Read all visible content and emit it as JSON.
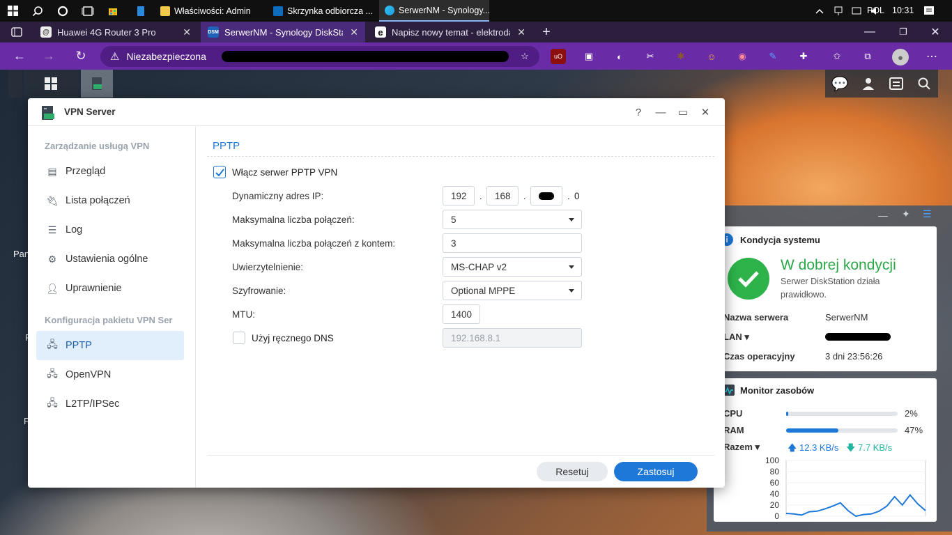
{
  "taskbar": {
    "apps": [
      {
        "label": "Właściwości: Admin"
      },
      {
        "label": "Skrzynka odbiorcza ..."
      },
      {
        "label": "SerwerNM - Synology..."
      }
    ],
    "lang": "POL",
    "time": "10:31"
  },
  "browser": {
    "tabs": [
      {
        "label": "Huawei 4G Router 3 Pro"
      },
      {
        "label": "SerwerNM - Synology DiskStation"
      },
      {
        "label": "Napisz nowy temat - elektroda.p"
      }
    ],
    "security_label": "Niezabezpieczona"
  },
  "desktop": {
    "side_labels": [
      "Pan",
      "P",
      "P"
    ]
  },
  "window": {
    "title": "VPN Server",
    "sections": [
      {
        "title": "Zarządzanie usługą VPN",
        "items": [
          "Przegląd",
          "Lista połączeń",
          "Log",
          "Ustawienia ogólne",
          "Uprawnienie"
        ]
      },
      {
        "title": "Konfiguracja pakietu VPN Ser",
        "items": [
          "PPTP",
          "OpenVPN",
          "L2TP/IPSec"
        ]
      }
    ],
    "selected_item": "PPTP",
    "content": {
      "heading": "PPTP",
      "enable_label": "Włącz serwer PPTP VPN",
      "enable_checked": true,
      "dynamic_ip_label": "Dynamiczny adres IP:",
      "dynamic_ip": [
        "192",
        "168",
        "",
        "0"
      ],
      "max_conn_label": "Maksymalna liczba połączeń:",
      "max_conn_value": "5",
      "max_conn_account_label": "Maksymalna liczba połączeń z kontem:",
      "max_conn_account_value": "3",
      "auth_label": "Uwierzytelnienie:",
      "auth_value": "MS-CHAP v2",
      "encryption_label": "Szyfrowanie:",
      "encryption_value": "Optional MPPE",
      "mtu_label": "MTU:",
      "mtu_value": "1400",
      "manual_dns_label": "Użyj ręcznego DNS",
      "manual_dns_checked": false,
      "manual_dns_placeholder": "192.168.8.1"
    },
    "buttons": {
      "reset": "Resetuj",
      "apply": "Zastosuj"
    }
  },
  "health": {
    "title": "Kondycja systemu",
    "status": "W dobrej kondycji",
    "desc_line1": "Serwer DiskStation działa",
    "desc_line2": "prawidłowo.",
    "server_name_label": "Nazwa serwera",
    "server_name": "SerwerNM",
    "lan_label": "LAN",
    "uptime_label": "Czas operacyjny",
    "uptime": "3 dni 23:56:26"
  },
  "monitor": {
    "title": "Monitor zasobów",
    "cpu_label": "CPU",
    "cpu_value": "2%",
    "cpu_fraction": 0.02,
    "ram_label": "RAM",
    "ram_value": "47%",
    "ram_fraction": 0.47,
    "net_label": "Razem",
    "upload": "12.3 KB/s",
    "download": "7.7 KB/s"
  },
  "chart_data": {
    "type": "line",
    "title": "",
    "xlabel": "",
    "ylabel": "",
    "ylim": [
      0,
      100
    ],
    "yticks": [
      "100",
      "80",
      "60",
      "40",
      "20",
      "0"
    ],
    "series": [
      {
        "values": [
          5,
          4,
          2,
          8,
          9,
          13,
          18,
          24,
          10,
          0,
          3,
          4,
          9,
          18,
          35,
          20,
          38,
          22,
          10
        ]
      }
    ]
  }
}
